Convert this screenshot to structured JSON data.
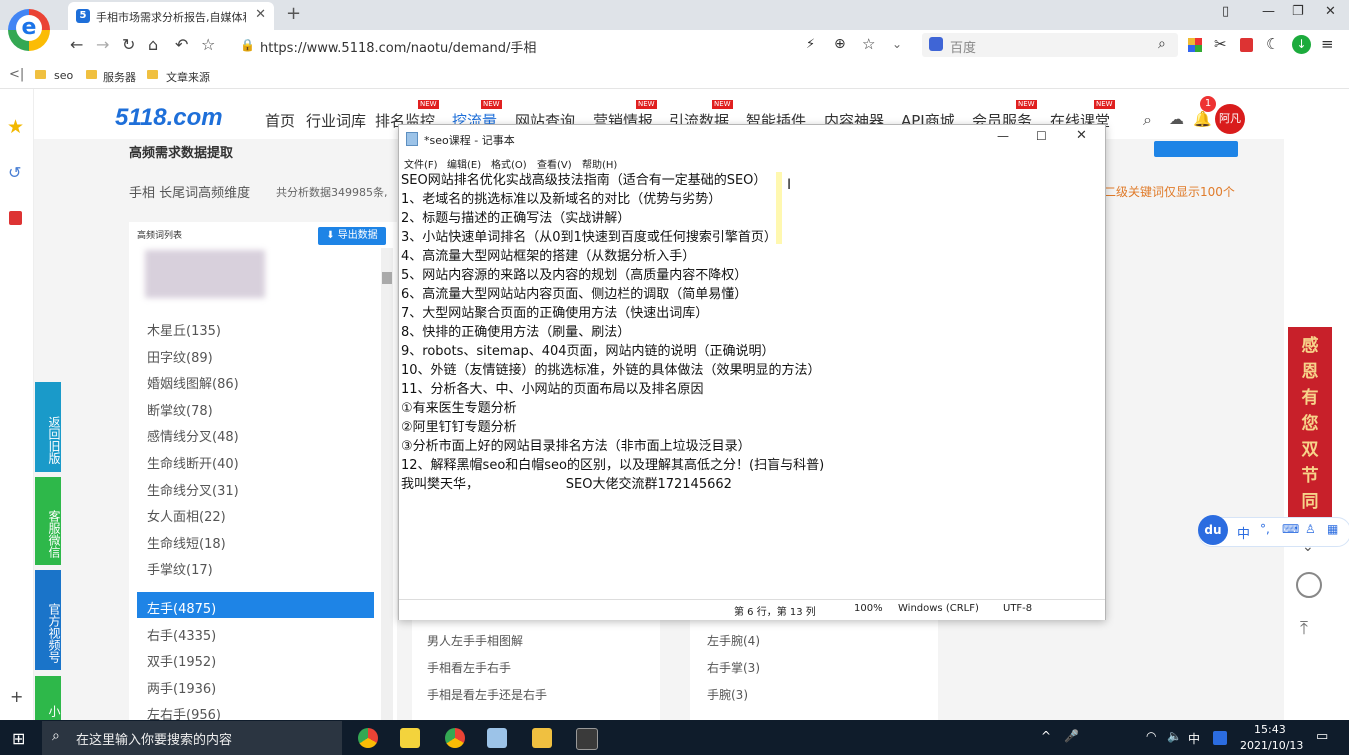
{
  "browser": {
    "tab_title": "手相市场需求分析报告,自媒体和…",
    "url": "https://www.5118.com/naotu/demand/手相",
    "search_placeholder": "百度",
    "bookmarks": [
      "seo",
      "服务器",
      "文章来源"
    ]
  },
  "site": {
    "logo": "5118.com",
    "nav": [
      "首页",
      "行业词库",
      "排名监控",
      "挖流量",
      "网站查询",
      "营销情报",
      "引流数据",
      "智能插件",
      "内容神器",
      "API商城",
      "会员服务",
      "在线课堂"
    ],
    "new_badge": "NEW",
    "notification_count": "1",
    "user_name": "阿凡",
    "section_title": "高频需求数据提取",
    "breadcrumb": "手相 长尾词高频维度",
    "total_data": "共分析数据349985条,",
    "right_note": "二级关键词仅显示100个",
    "list_header": "高频词列表",
    "export_button": "导出数据",
    "keyword_list": [
      "木星丘(135)",
      "田字纹(89)",
      "婚姻线图解(86)",
      "断掌纹(78)",
      "感情线分叉(48)",
      "生命线断开(40)",
      "生命线分叉(31)",
      "女人面相(22)",
      "生命线短(18)",
      "手掌纹(17)"
    ],
    "active_keyword": "左手(4875)",
    "keyword_list_2": [
      "右手(4335)",
      "双手(1952)",
      "两手(1936)",
      "左右手(956)"
    ],
    "mid_items": [
      "男人左手手相图解",
      "手相看左手右手",
      "手相是看左手还是右手"
    ],
    "right_items": [
      "左手腕(4)",
      "右手掌(3)",
      "手腕(3)"
    ],
    "side_buttons": [
      "返回旧版",
      "客服微信",
      "官方视频号",
      "小"
    ],
    "banner_text": "感恩有您双节同庆"
  },
  "notepad": {
    "title": "*seo课程 - 记事本",
    "menu": [
      "文件(F)",
      "编辑(E)",
      "格式(O)",
      "查看(V)",
      "帮助(H)"
    ],
    "lines": [
      "SEO网站排名优化实战高级技法指南（适合有一定基础的SEO）",
      "",
      "1、老域名的挑选标准以及新域名的对比（优势与劣势）",
      "2、标题与描述的正确写法（实战讲解）",
      "3、小站快速单词排名（从0到1快速到百度或任何搜索引擎首页）",
      "4、高流量大型网站框架的搭建（从数据分析入手）",
      "5、网站内容源的来路以及内容的规划（高质量内容不降权）",
      "6、高流量大型网站站内容页面、侧边栏的调取（简单易懂）",
      "7、大型网站聚合页面的正确使用方法（快速出词库）",
      "8、快排的正确使用方法（刷量、刷法）",
      "9、robots、sitemap、404页面，网站内链的说明（正确说明）",
      "10、外链（友情链接）的挑选标准，外链的具体做法（效果明显的方法）",
      "11、分析各大、中、小网站的页面布局以及排名原因",
      "①有来医生专题分析",
      "②阿里钉钉专题分析",
      "③分析市面上好的网站目录排名方法（非市面上垃圾泛目录）",
      "12、解释黑帽seo和白帽seo的区别，以及理解其高低之分！(扫盲与科普)",
      "",
      "我叫樊天华，                     SEO大佬交流群172145662"
    ],
    "status": {
      "position": "第 6 行，第 13 列",
      "zoom": "100%",
      "line_ending": "Windows (CRLF)",
      "encoding": "UTF-8"
    }
  },
  "ime": {
    "logo": "du",
    "mode": "中"
  },
  "taskbar": {
    "search_placeholder": "在这里输入你要搜索的内容",
    "tray_lang": "中",
    "time": "15:43",
    "date": "2021/10/13"
  },
  "colors": {
    "brand_blue": "#1e6fd9",
    "active_blue": "#1e84e6",
    "new_red": "#e02020",
    "taskbar": "#0f1c2b"
  }
}
